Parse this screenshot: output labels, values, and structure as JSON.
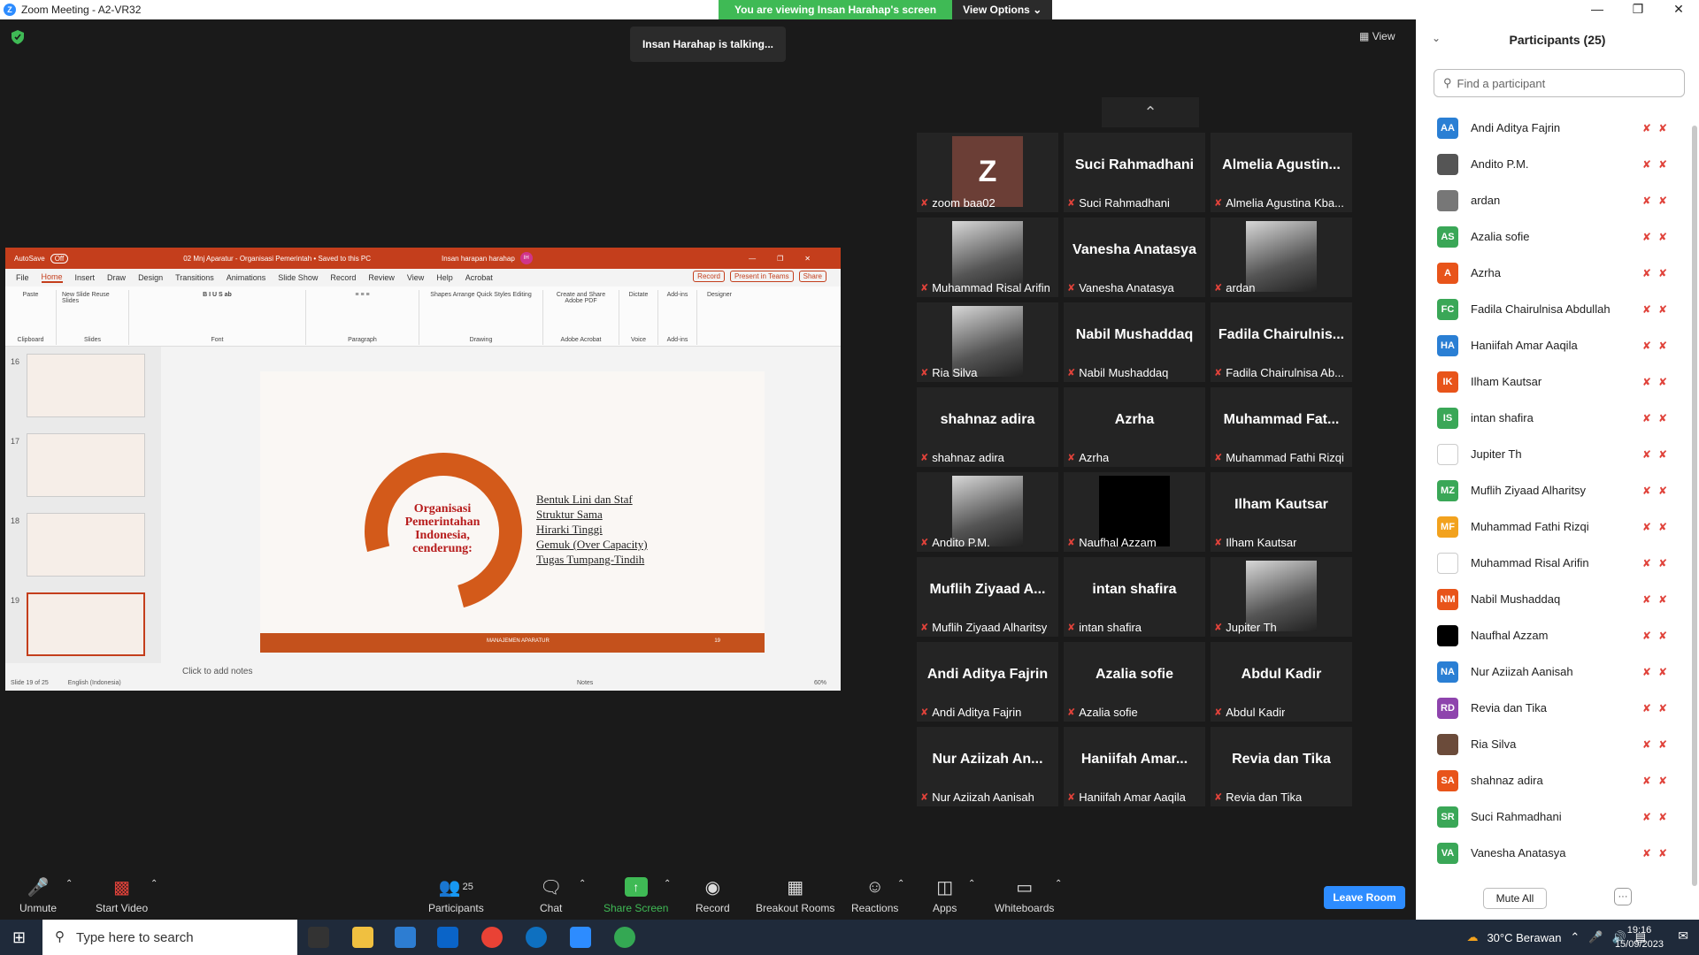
{
  "window": {
    "title": "Zoom Meeting - A2-VR32"
  },
  "banner": {
    "viewing": "You are viewing Insan Harahap's screen",
    "view_options": "View Options"
  },
  "talking": "Insan Harahap is talking...",
  "view_label": "View",
  "ppt": {
    "autosave": "AutoSave",
    "autosave_state": "Off",
    "doc_title": "02 Mnj Aparatur - Organisasi Pemerintah • Saved to this PC",
    "user": "Insan harapan harahap",
    "user_initials": "IH",
    "tabs": [
      "File",
      "Home",
      "Insert",
      "Draw",
      "Design",
      "Transitions",
      "Animations",
      "Slide Show",
      "Record",
      "Review",
      "View",
      "Help",
      "Acrobat"
    ],
    "record_btn": "Record",
    "present_btn": "Present in Teams",
    "share_btn": "Share",
    "groups": [
      "Clipboard",
      "Slides",
      "Font",
      "Paragraph",
      "Drawing",
      "Adobe Acrobat",
      "Voice",
      "Add-ins"
    ],
    "ribbon_items": [
      "Paste",
      "New Slide",
      "Reuse Slides",
      "Shapes",
      "Arrange",
      "Quick Styles",
      "Editing",
      "Create and Share Adobe PDF",
      "Dictate",
      "Add-ins",
      "Designer"
    ],
    "thumb_numbers": [
      "16",
      "17",
      "18",
      "19"
    ],
    "slide_center": "Organisasi Pemerintahan Indonesia, cenderung:",
    "bullets": [
      "Bentuk Lini dan Staf",
      "Struktur Sama",
      "Hirarki Tinggi",
      "Gemuk (Over Capacity)",
      "Tugas Tumpang-Tindih"
    ],
    "footer_text": "MANAJEMEN APARATUR",
    "footer_num": "19",
    "notes": "Click to add notes",
    "status_left": "Slide 19 of 25",
    "status_lang": "English (Indonesia)",
    "status_notes": "Notes",
    "zoom": "60%"
  },
  "tiles": [
    {
      "big": "Z",
      "label": "zoom baa02",
      "type": "letter"
    },
    {
      "big": "Suci Rahmadhani",
      "label": "Suci Rahmadhani",
      "type": "name"
    },
    {
      "big": "Almelia  Agustin...",
      "label": "Almelia Agustina Kba...",
      "type": "name"
    },
    {
      "big": "",
      "label": "Muhammad Risal Arifin",
      "type": "photo"
    },
    {
      "big": "Vanesha Anatasya",
      "label": "Vanesha Anatasya",
      "type": "name"
    },
    {
      "big": "",
      "label": "ardan",
      "type": "photo"
    },
    {
      "big": "",
      "label": "Ria Silva",
      "type": "photo"
    },
    {
      "big": "Nabil Mushaddaq",
      "label": "Nabil Mushaddaq",
      "type": "name"
    },
    {
      "big": "Fadila  Chairulnis...",
      "label": "Fadila Chairulnisa Ab...",
      "type": "name"
    },
    {
      "big": "shahnaz adira",
      "label": "shahnaz adira",
      "type": "name"
    },
    {
      "big": "Azrha",
      "label": "Azrha",
      "type": "name"
    },
    {
      "big": "Muhammad  Fat...",
      "label": "Muhammad Fathi Rizqi",
      "type": "name"
    },
    {
      "big": "",
      "label": "Andito P.M.",
      "type": "photo"
    },
    {
      "big": "",
      "label": "Naufhal Azzam",
      "type": "black"
    },
    {
      "big": "Ilham Kautsar",
      "label": "Ilham Kautsar",
      "type": "name"
    },
    {
      "big": "Muflih  Ziyaad  A...",
      "label": "Muflih Ziyaad Alharitsy",
      "type": "name"
    },
    {
      "big": "intan shafira",
      "label": "intan shafira",
      "type": "name"
    },
    {
      "big": "",
      "label": "Jupiter Th",
      "type": "photo"
    },
    {
      "big": "Andi Aditya Fajrin",
      "label": "Andi Aditya Fajrin",
      "type": "name"
    },
    {
      "big": "Azalia sofie",
      "label": "Azalia sofie",
      "type": "name"
    },
    {
      "big": "Abdul Kadir",
      "label": "Abdul Kadir",
      "type": "name"
    },
    {
      "big": "Nur  Aziizah  An...",
      "label": "Nur Aziizah Aanisah",
      "type": "name"
    },
    {
      "big": "Haniifah  Amar...",
      "label": "Haniifah Amar Aaqila",
      "type": "name"
    },
    {
      "big": "Revia dan Tika",
      "label": "Revia dan Tika",
      "type": "name"
    }
  ],
  "participants": {
    "title": "Participants (25)",
    "search_placeholder": "Find a participant",
    "list": [
      {
        "initials": "AA",
        "name": "Andi Aditya Fajrin",
        "color": "#2a7fd4"
      },
      {
        "initials": "",
        "name": "Andito P.M.",
        "color": "#555555"
      },
      {
        "initials": "",
        "name": "ardan",
        "color": "#777777"
      },
      {
        "initials": "AS",
        "name": "Azalia sofie",
        "color": "#3aa757"
      },
      {
        "initials": "A",
        "name": "Azrha",
        "color": "#e8541a"
      },
      {
        "initials": "FC",
        "name": "Fadila Chairulnisa Abdullah",
        "color": "#3aa757"
      },
      {
        "initials": "HA",
        "name": "Haniifah Amar Aaqila",
        "color": "#2a7fd4"
      },
      {
        "initials": "IK",
        "name": "Ilham Kautsar",
        "color": "#e8541a"
      },
      {
        "initials": "IS",
        "name": "intan shafira",
        "color": "#3aa757"
      },
      {
        "initials": "",
        "name": "Jupiter Th",
        "color": "#ffffff"
      },
      {
        "initials": "MZ",
        "name": "Muflih Ziyaad Alharitsy",
        "color": "#3aa757"
      },
      {
        "initials": "MF",
        "name": "Muhammad Fathi Rizqi",
        "color": "#f2a21e"
      },
      {
        "initials": "",
        "name": "Muhammad Risal Arifin",
        "color": "#ffffff"
      },
      {
        "initials": "NM",
        "name": "Nabil Mushaddaq",
        "color": "#e8541a"
      },
      {
        "initials": "",
        "name": "Naufhal Azzam",
        "color": "#000000"
      },
      {
        "initials": "NA",
        "name": "Nur Aziizah Aanisah",
        "color": "#2a7fd4"
      },
      {
        "initials": "RD",
        "name": "Revia dan Tika",
        "color": "#8e44ad"
      },
      {
        "initials": "",
        "name": "Ria Silva",
        "color": "#6b4b3a"
      },
      {
        "initials": "SA",
        "name": "shahnaz adira",
        "color": "#e8541a"
      },
      {
        "initials": "SR",
        "name": "Suci Rahmadhani",
        "color": "#3aa757"
      },
      {
        "initials": "VA",
        "name": "Vanesha Anatasya",
        "color": "#3aa757"
      }
    ],
    "mute_all": "Mute All",
    "more": "···"
  },
  "toolbar": {
    "unmute": "Unmute",
    "start_video": "Start Video",
    "participants": "Participants",
    "participants_count": "25",
    "chat": "Chat",
    "share_screen": "Share Screen",
    "record": "Record",
    "breakout": "Breakout Rooms",
    "reactions": "Reactions",
    "apps": "Apps",
    "whiteboards": "Whiteboards",
    "leave": "Leave Room"
  },
  "taskbar": {
    "search_placeholder": "Type here to search",
    "weather": "30°C  Berawan",
    "time": "19:16",
    "date": "15/09/2023"
  },
  "colors": {
    "accent": "#2d8cff",
    "green": "#3fba55",
    "ppt_red": "#c43e1c",
    "muted": "#e0423a"
  }
}
